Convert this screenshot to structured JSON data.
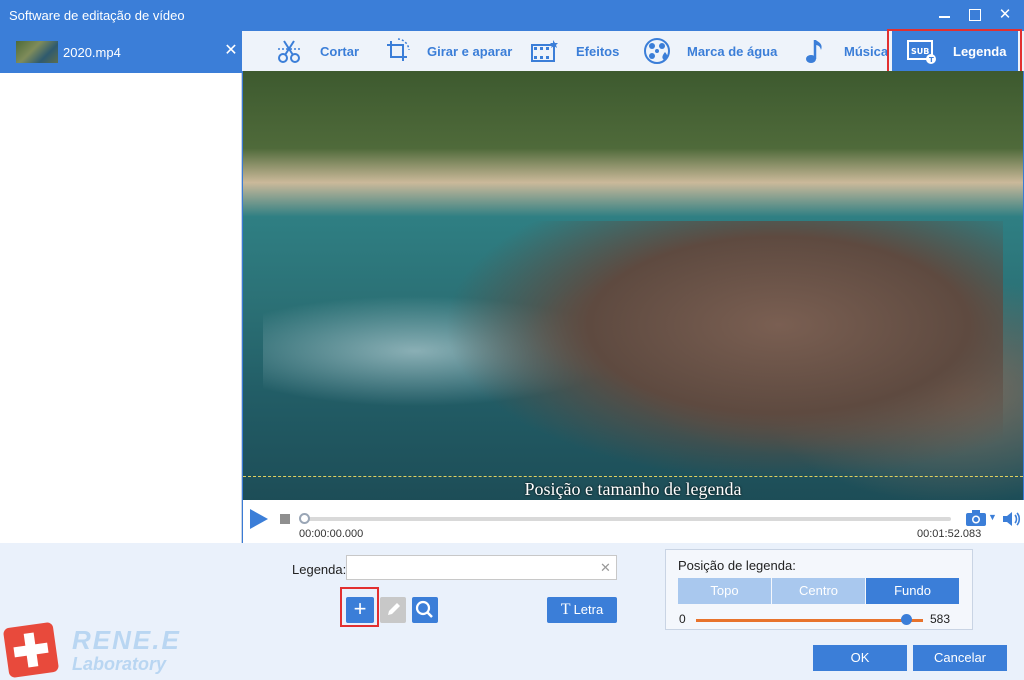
{
  "window": {
    "title": "Software de editação de vídeo"
  },
  "files": [
    {
      "name": "2020.mp4"
    }
  ],
  "toolbar": {
    "tabs": [
      {
        "label": "Cortar",
        "icon": "scissors-icon"
      },
      {
        "label": "Girar e aparar",
        "icon": "rotate-crop-icon"
      },
      {
        "label": "Efeitos",
        "icon": "effects-icon"
      },
      {
        "label": "Marca de água",
        "icon": "watermark-icon"
      },
      {
        "label": "Música",
        "icon": "music-note-icon"
      },
      {
        "label": "Legenda",
        "icon": "subtitle-icon",
        "active": true
      }
    ]
  },
  "video": {
    "caption": "Posição e tamanho de legenda"
  },
  "player": {
    "current_time": "00:00:00.000",
    "total_time": "00:01:52.083"
  },
  "subtitle": {
    "label": "Legenda:",
    "value": "",
    "letra_label": "Letra"
  },
  "position": {
    "title": "Posição de legenda:",
    "options": [
      "Topo",
      "Centro",
      "Fundo"
    ],
    "selected": "Fundo",
    "slider_min": "0",
    "slider_max": "583"
  },
  "logo": {
    "line1": "RENE.E",
    "line2": "Laboratory"
  },
  "actions": {
    "ok": "OK",
    "cancel": "Cancelar"
  },
  "colors": {
    "accent": "#3b7ed8",
    "highlight": "#e23030",
    "slider": "#e8732c"
  }
}
